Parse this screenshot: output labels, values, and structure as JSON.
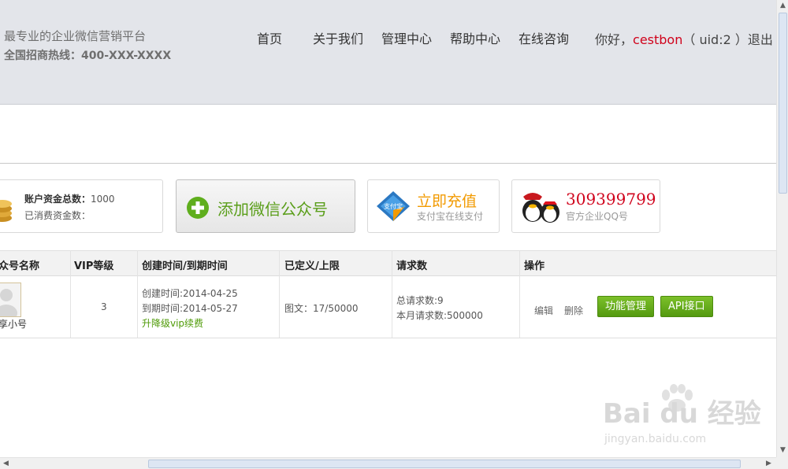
{
  "header": {
    "slogan": "最专业的企业微信营销平台",
    "hotline": "全国招商热线：400-XXX-XXXX",
    "nav": [
      "首页",
      "关于我们",
      "管理中心",
      "帮助中心",
      "在线咨询"
    ],
    "greeting_prefix": "你好，",
    "username": "cestbon",
    "uid_text": "（ uid:2 ）",
    "logout": "退出"
  },
  "cards": {
    "balance": {
      "total_label": "账户资金总数：",
      "total_value": "1000",
      "spent_label": "已消费资金数："
    },
    "add_account": {
      "label": "添加微信公众号"
    },
    "recharge": {
      "title": "立即充值",
      "subtitle": "支付宝在线支付",
      "badge": "支付宝"
    },
    "qq": {
      "number": "309399799",
      "subtitle": "官方企业QQ号"
    }
  },
  "table": {
    "headers": [
      "众号名称",
      "VIP等级",
      "创建时间/到期时间",
      "已定义/上限",
      "请求数",
      "操作"
    ],
    "rows": [
      {
        "name": "享小号",
        "vip": "3",
        "created": "创建时间:2014-04-25",
        "expires": "到期时间:2014-05-27",
        "upgrade_link": "升降级vip续费",
        "defined": "图文：17/50000",
        "total_requests": "总请求数:9",
        "monthly_requests": "本月请求数:500000",
        "actions": {
          "edit": "编辑",
          "delete": "删除",
          "manage": "功能管理",
          "api": "API接口"
        }
      }
    ]
  },
  "watermark": {
    "brand": "Bai du 经验",
    "url": "jingyan.baidu.com"
  },
  "colors": {
    "accent_red": "#d0021b",
    "green": "#5a9e1a",
    "orange": "#f29a00",
    "header_bg": "#e3e5ea"
  }
}
